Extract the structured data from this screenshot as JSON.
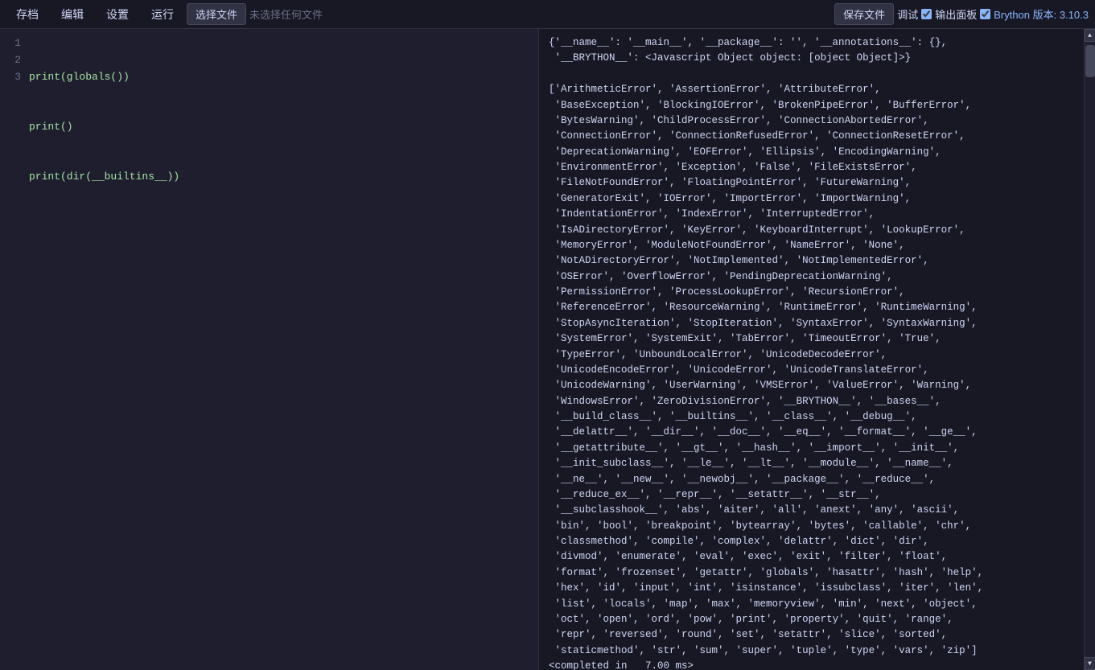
{
  "menubar": {
    "items": [
      {
        "label": "存档",
        "id": "menu-save"
      },
      {
        "label": "编辑",
        "id": "menu-edit"
      },
      {
        "label": "设置",
        "id": "menu-settings"
      },
      {
        "label": "运行",
        "id": "menu-run"
      }
    ],
    "select_file_btn": "选择文件",
    "no_file_label": "未选择任何文件",
    "save_file_btn": "保存文件",
    "debug_label": "调试",
    "output_panel_label": "输出面板",
    "brython_version_label": "Brython 版本: 3.10.3"
  },
  "editor": {
    "lines": [
      {
        "num": "1",
        "code": "print(globals())"
      },
      {
        "num": "2",
        "code": "print()"
      },
      {
        "num": "3",
        "code": "print(dir(__builtins__))"
      }
    ]
  },
  "output": {
    "text": "{'__name__': '__main__', '__package__': '', '__annotations__': {},\n '__BRYTHON__': <Javascript Object object: [object Object]>}\n\n['ArithmeticError', 'AssertionError', 'AttributeError',\n 'BaseException', 'BlockingIOError', 'BrokenPipeError', 'BufferError',\n 'BytesWarning', 'ChildProcessError', 'ConnectionAbortedError',\n 'ConnectionError', 'ConnectionRefusedError', 'ConnectionResetError',\n 'DeprecationWarning', 'EOFError', 'Ellipsis', 'EncodingWarning',\n 'EnvironmentError', 'Exception', 'False', 'FileExistsError',\n 'FileNotFoundError', 'FloatingPointError', 'FutureWarning',\n 'GeneratorExit', 'IOError', 'ImportError', 'ImportWarning',\n 'IndentationError', 'IndexError', 'InterruptedError',\n 'IsADirectoryError', 'KeyError', 'KeyboardInterrupt', 'LookupError',\n 'MemoryError', 'ModuleNotFoundError', 'NameError', 'None',\n 'NotADirectoryError', 'NotImplemented', 'NotImplementedError',\n 'OSError', 'OverflowError', 'PendingDeprecationWarning',\n 'PermissionError', 'ProcessLookupError', 'RecursionError',\n 'ReferenceError', 'ResourceWarning', 'RuntimeError', 'RuntimeWarning',\n 'StopAsyncIteration', 'StopIteration', 'SyntaxError', 'SyntaxWarning',\n 'SystemError', 'SystemExit', 'TabError', 'TimeoutError', 'True',\n 'TypeError', 'UnboundLocalError', 'UnicodeDecodeError',\n 'UnicodeEncodeError', 'UnicodeError', 'UnicodeTranslateError',\n 'UnicodeWarning', 'UserWarning', 'VMSError', 'ValueError', 'Warning',\n 'WindowsError', 'ZeroDivisionError', '__BRYTHON__', '__bases__',\n '__build_class__', '__builtins__', '__class__', '__debug__',\n '__delattr__', '__dir__', '__doc__', '__eq__', '__format__', '__ge__',\n '__getattribute__', '__gt__', '__hash__', '__import__', '__init__',\n '__init_subclass__', '__le__', '__lt__', '__module__', '__name__',\n '__ne__', '__new__', '__newobj__', '__package__', '__reduce__',\n '__reduce_ex__', '__repr__', '__setattr__', '__str__',\n '__subclasshook__', 'abs', 'aiter', 'all', 'anext', 'any', 'ascii',\n 'bin', 'bool', 'breakpoint', 'bytearray', 'bytes', 'callable', 'chr',\n 'classmethod', 'compile', 'complex', 'delattr', 'dict', 'dir',\n 'divmod', 'enumerate', 'eval', 'exec', 'exit', 'filter', 'float',\n 'format', 'frozenset', 'getattr', 'globals', 'hasattr', 'hash', 'help',\n 'hex', 'id', 'input', 'int', 'isinstance', 'issubclass', 'iter', 'len',\n 'list', 'locals', 'map', 'max', 'memoryview', 'min', 'next', 'object',\n 'oct', 'open', 'ord', 'pow', 'print', 'property', 'quit', 'range',\n 'repr', 'reversed', 'round', 'set', 'setattr', 'slice', 'sorted',\n 'staticmethod', 'str', 'sum', 'super', 'tuple', 'type', 'vars', 'zip']\n<completed in   7.00 ms>"
  },
  "scrollbar": {
    "up_arrow": "▲",
    "down_arrow": "▼"
  }
}
